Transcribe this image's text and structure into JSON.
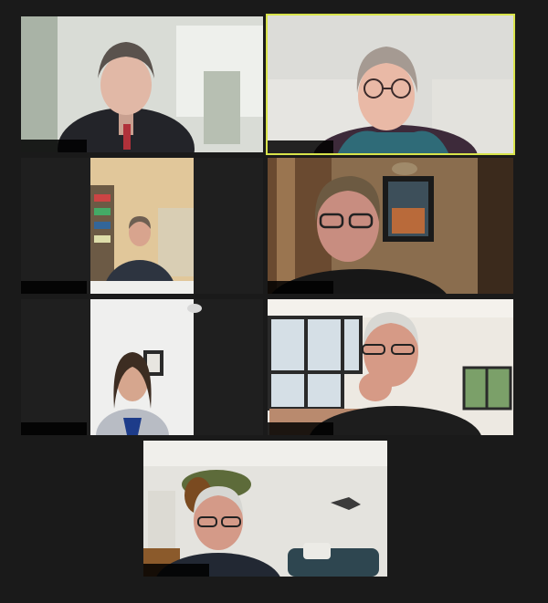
{
  "meeting": {
    "app": "Zoom",
    "view": "gallery",
    "active_speaker_index": 1,
    "colors": {
      "background": "#1a1a1a",
      "active_border": "#d8e34a"
    }
  },
  "participants": [
    {
      "name": "",
      "scene": "glasshouse-room"
    },
    {
      "name": "",
      "scene": "white-couch"
    },
    {
      "name": "",
      "scene": "home-office-bookshelf"
    },
    {
      "name": "",
      "scene": "curtains-painting"
    },
    {
      "name": "",
      "scene": "bright-white-room"
    },
    {
      "name": "",
      "scene": "conservatory-windows"
    },
    {
      "name": "",
      "scene": "lounge-sofa"
    }
  ]
}
